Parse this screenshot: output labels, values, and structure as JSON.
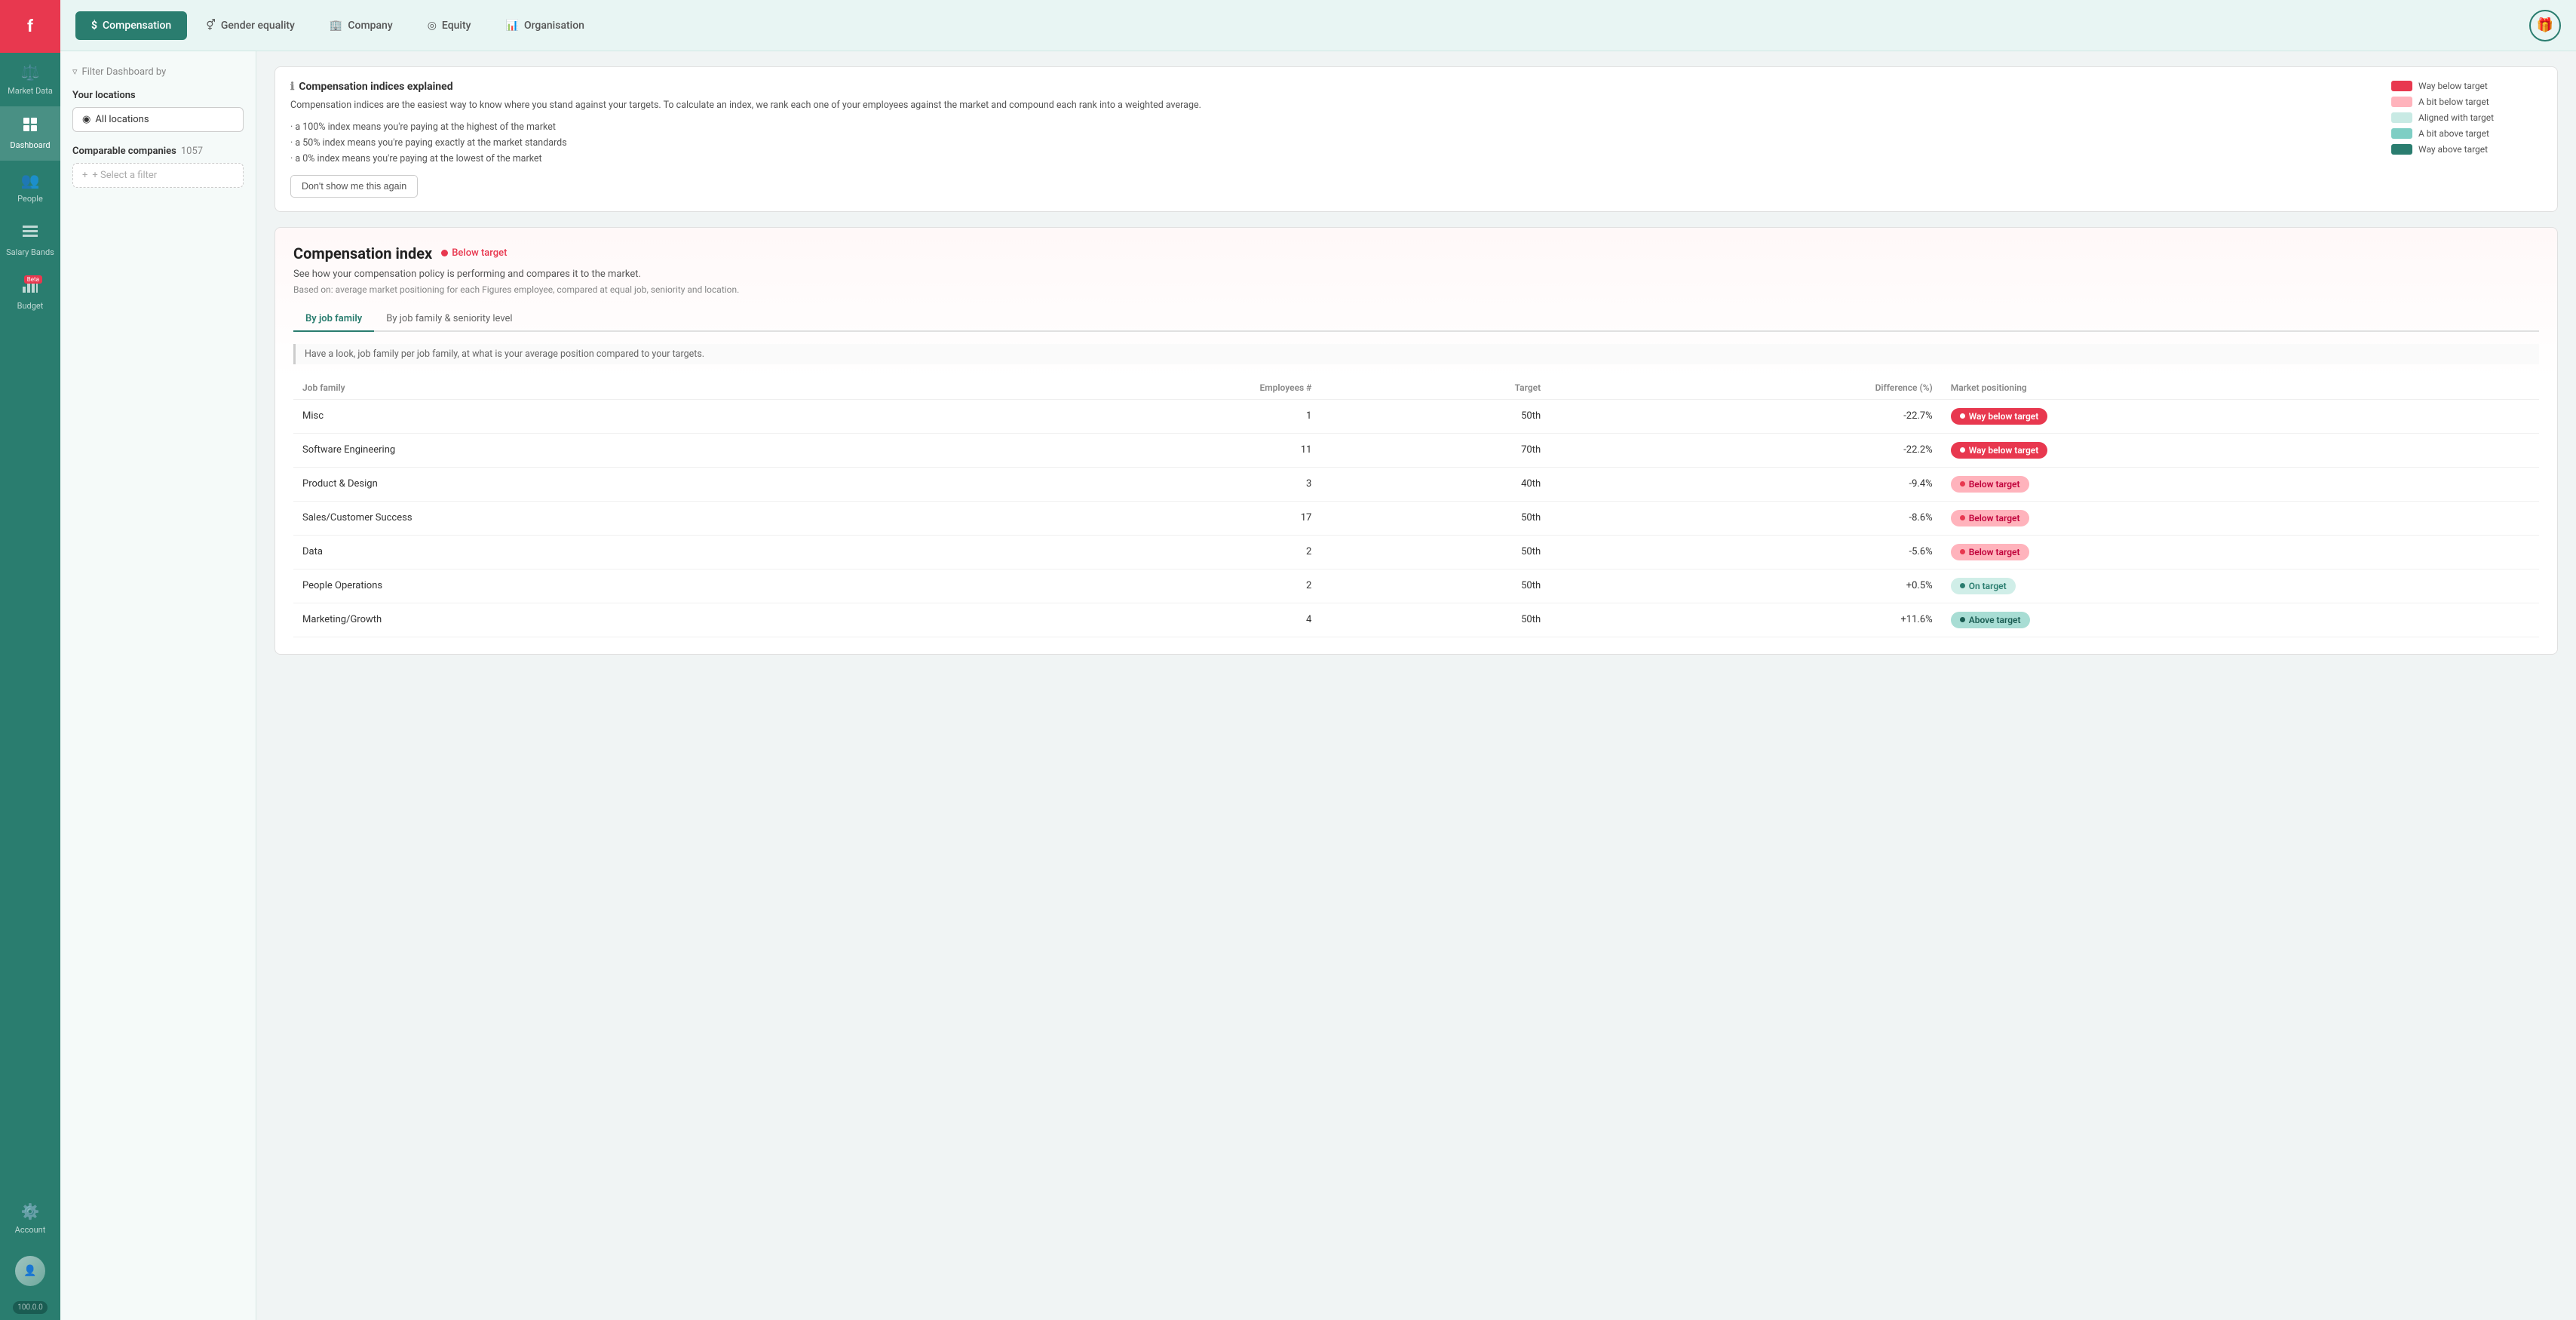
{
  "sidebar": {
    "logo": "f",
    "items": [
      {
        "id": "market-data",
        "label": "Market Data",
        "icon": "⚖️",
        "active": false
      },
      {
        "id": "dashboard",
        "label": "Dashboard",
        "icon": "⊞",
        "active": true
      },
      {
        "id": "people",
        "label": "People",
        "icon": "👥",
        "active": false
      },
      {
        "id": "salary-bands",
        "label": "Salary Bands",
        "icon": "▤",
        "active": false
      },
      {
        "id": "budget",
        "label": "Budget",
        "icon": "📊",
        "active": false,
        "beta": true
      },
      {
        "id": "account",
        "label": "Account",
        "icon": "⚙️",
        "active": false
      }
    ],
    "version": "100.0.0"
  },
  "topnav": {
    "tabs": [
      {
        "id": "compensation",
        "label": "Compensation",
        "icon": "$",
        "active": true
      },
      {
        "id": "gender-equality",
        "label": "Gender equality",
        "icon": "♀",
        "active": false
      },
      {
        "id": "company",
        "label": "Company",
        "icon": "🏢",
        "active": false
      },
      {
        "id": "equity",
        "label": "Equity",
        "icon": "◎",
        "active": false
      },
      {
        "id": "organisation",
        "label": "Organisation",
        "icon": "📊",
        "active": false
      }
    ],
    "gift_btn": "🎁"
  },
  "filter": {
    "header": "Filter Dashboard by",
    "locations_title": "Your locations",
    "location_value": "All locations",
    "comparable_title": "Comparable companies",
    "comparable_count": "1057",
    "filter_placeholder": "+ Select a filter"
  },
  "info_box": {
    "title": "Compensation indices explained",
    "text": "Compensation indices are the easiest way to know where you stand against your targets. To calculate an index, we rank each one of your employees against the market and compound each rank into a weighted average.",
    "bullets": [
      "a 100% index means you're paying at the highest of the market",
      "a 50% index means you're paying exactly at the market standards",
      "a 0% index means you're paying at the lowest of the market"
    ],
    "dont_show_label": "Don't show me this again",
    "legend": [
      {
        "label": "Way below target",
        "color": "#e8384f"
      },
      {
        "label": "A bit below target",
        "color": "#ffb3bc"
      },
      {
        "label": "Aligned with target",
        "color": "#c8eae4"
      },
      {
        "label": "A bit above target",
        "color": "#7ecec4"
      },
      {
        "label": "Way above target",
        "color": "#2a7d6f"
      }
    ]
  },
  "comp_index": {
    "title": "Compensation index",
    "status_label": "Below target",
    "status_color": "#e8384f",
    "desc": "See how your compensation policy is performing and compares it to the market.",
    "based_on": "Based on: average market positioning for each Figures employee, compared at equal job, seniority and location.",
    "tabs": [
      {
        "id": "by-job-family",
        "label": "By job family",
        "active": true
      },
      {
        "id": "by-job-family-seniority",
        "label": "By job family & seniority level",
        "active": false
      }
    ],
    "note": "Have a look, job family per job family, at what is your average position compared to your targets.",
    "table": {
      "headers": [
        {
          "id": "job-family",
          "label": "Job family"
        },
        {
          "id": "employees",
          "label": "Employees #",
          "align": "right"
        },
        {
          "id": "target",
          "label": "Target",
          "align": "right"
        },
        {
          "id": "difference",
          "label": "Difference (%)",
          "align": "right"
        },
        {
          "id": "market-positioning",
          "label": "Market positioning"
        }
      ],
      "rows": [
        {
          "job_family": "Misc",
          "employees": "1",
          "target": "50th",
          "difference": "-22.7%",
          "badge": "Way below target",
          "badge_type": "way-below"
        },
        {
          "job_family": "Software Engineering",
          "employees": "11",
          "target": "70th",
          "difference": "-22.2%",
          "badge": "Way below target",
          "badge_type": "way-below"
        },
        {
          "job_family": "Product & Design",
          "employees": "3",
          "target": "40th",
          "difference": "-9.4%",
          "badge": "Below target",
          "badge_type": "below"
        },
        {
          "job_family": "Sales/Customer Success",
          "employees": "17",
          "target": "50th",
          "difference": "-8.6%",
          "badge": "Below target",
          "badge_type": "below"
        },
        {
          "job_family": "Data",
          "employees": "2",
          "target": "50th",
          "difference": "-5.6%",
          "badge": "Below target",
          "badge_type": "below"
        },
        {
          "job_family": "People Operations",
          "employees": "2",
          "target": "50th",
          "difference": "+0.5%",
          "badge": "On target",
          "badge_type": "on-target"
        },
        {
          "job_family": "Marketing/Growth",
          "employees": "4",
          "target": "50th",
          "difference": "+11.6%",
          "badge": "Above target",
          "badge_type": "above"
        }
      ]
    }
  }
}
